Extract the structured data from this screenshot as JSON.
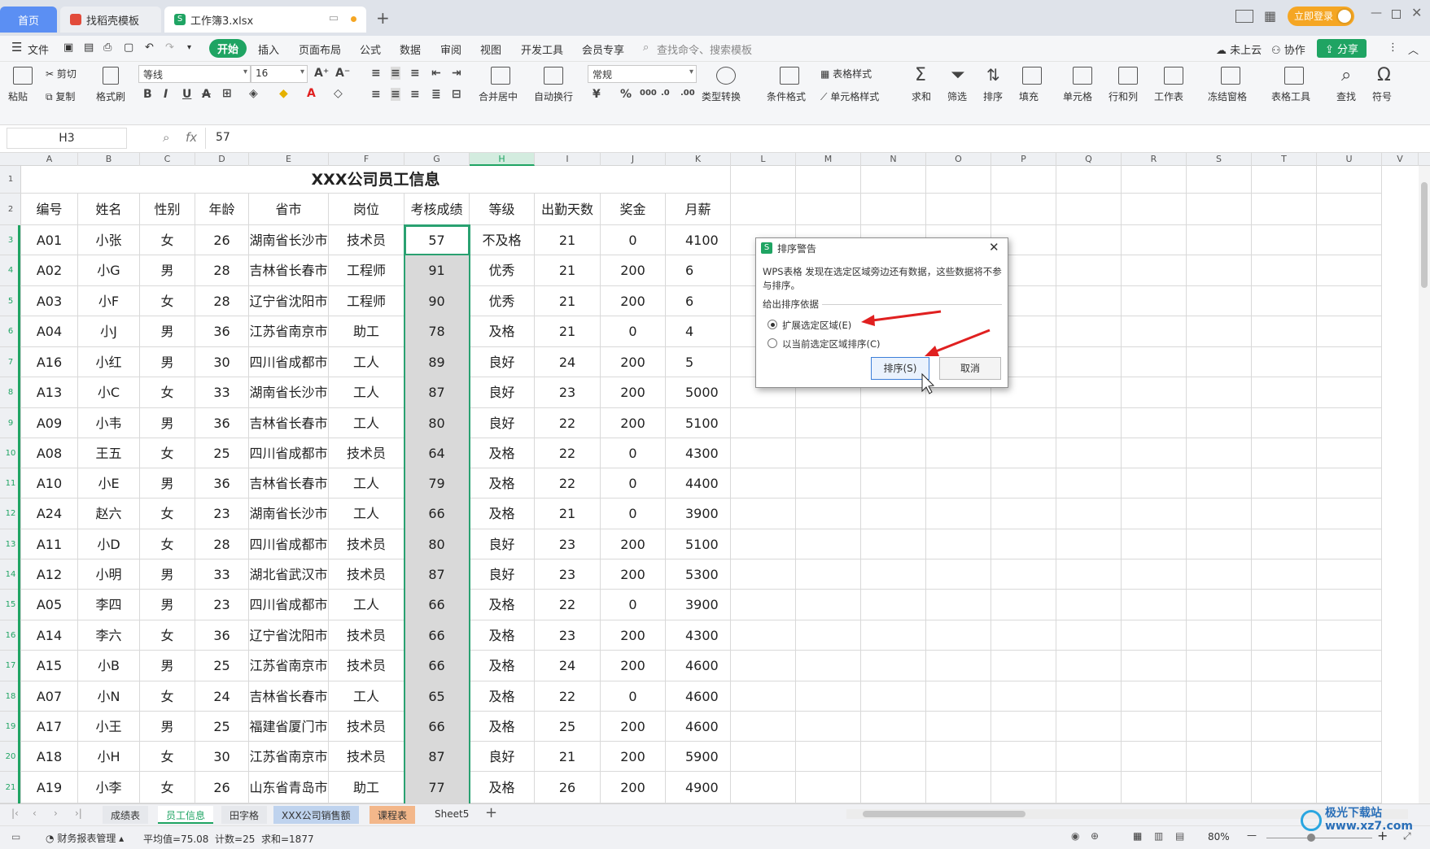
{
  "tabs": {
    "home": "首页",
    "template": "找稻壳模板",
    "workbook": "工作簿3.xlsx",
    "login": "立即登录"
  },
  "menu": {
    "file": "文件",
    "items": [
      "开始",
      "插入",
      "页面布局",
      "公式",
      "数据",
      "审阅",
      "视图",
      "开发工具",
      "会员专享"
    ],
    "search": "查找命令、搜索模板",
    "cloud": "未上云",
    "collab": "协作",
    "share": "分享"
  },
  "ribbon": {
    "paste": "粘贴",
    "cut": "剪切",
    "copy": "复制",
    "format_painter": "格式刷",
    "font_name": "等线",
    "font_size": "16",
    "merge": "合并居中",
    "wrap": "自动换行",
    "number_format": "常规",
    "convert": "类型转换",
    "cond_format": "条件格式",
    "table_style": "表格样式",
    "cell_style": "单元格样式",
    "sum": "求和",
    "filter": "筛选",
    "sort": "排序",
    "fill": "填充",
    "cell": "单元格",
    "rowcol": "行和列",
    "worksheet": "工作表",
    "freeze": "冻结窗格",
    "table_tools": "表格工具",
    "find": "查找",
    "symbol": "符号"
  },
  "formula_bar": {
    "name_box": "H3",
    "fx": "fx",
    "value": "57"
  },
  "columns": [
    "A",
    "B",
    "C",
    "D",
    "E",
    "F",
    "G",
    "H",
    "I",
    "J",
    "K",
    "L",
    "M",
    "N",
    "O",
    "P",
    "Q",
    "R",
    "S",
    "T",
    "U",
    "V"
  ],
  "sheet": {
    "title": "XXX公司员工信息",
    "headers": [
      "编号",
      "姓名",
      "性别",
      "年龄",
      "省市",
      "岗位",
      "考核成绩",
      "等级",
      "出勤天数",
      "奖金",
      "月薪"
    ],
    "rows": [
      [
        "A01",
        "小张",
        "女",
        "26",
        "湖南省长沙市",
        "技术员",
        "57",
        "不及格",
        "21",
        "0",
        "4100"
      ],
      [
        "A02",
        "小G",
        "男",
        "28",
        "吉林省长春市",
        "工程师",
        "91",
        "优秀",
        "21",
        "200",
        "6"
      ],
      [
        "A03",
        "小F",
        "女",
        "28",
        "辽宁省沈阳市",
        "工程师",
        "90",
        "优秀",
        "21",
        "200",
        "6"
      ],
      [
        "A04",
        "小J",
        "男",
        "36",
        "江苏省南京市",
        "助工",
        "78",
        "及格",
        "21",
        "0",
        "4"
      ],
      [
        "A16",
        "小红",
        "男",
        "30",
        "四川省成都市",
        "工人",
        "89",
        "良好",
        "24",
        "200",
        "5"
      ],
      [
        "A13",
        "小C",
        "女",
        "33",
        "湖南省长沙市",
        "工人",
        "87",
        "良好",
        "23",
        "200",
        "5000"
      ],
      [
        "A09",
        "小韦",
        "男",
        "36",
        "吉林省长春市",
        "工人",
        "80",
        "良好",
        "22",
        "200",
        "5100"
      ],
      [
        "A08",
        "王五",
        "女",
        "25",
        "四川省成都市",
        "技术员",
        "64",
        "及格",
        "22",
        "0",
        "4300"
      ],
      [
        "A10",
        "小E",
        "男",
        "36",
        "吉林省长春市",
        "工人",
        "79",
        "及格",
        "22",
        "0",
        "4400"
      ],
      [
        "A24",
        "赵六",
        "女",
        "23",
        "湖南省长沙市",
        "工人",
        "66",
        "及格",
        "21",
        "0",
        "3900"
      ],
      [
        "A11",
        "小D",
        "女",
        "28",
        "四川省成都市",
        "技术员",
        "80",
        "良好",
        "23",
        "200",
        "5100"
      ],
      [
        "A12",
        "小明",
        "男",
        "33",
        "湖北省武汉市",
        "技术员",
        "87",
        "良好",
        "23",
        "200",
        "5300"
      ],
      [
        "A05",
        "李四",
        "男",
        "23",
        "四川省成都市",
        "工人",
        "66",
        "及格",
        "22",
        "0",
        "3900"
      ],
      [
        "A14",
        "李六",
        "女",
        "36",
        "辽宁省沈阳市",
        "技术员",
        "66",
        "及格",
        "23",
        "200",
        "4300"
      ],
      [
        "A15",
        "小B",
        "男",
        "25",
        "江苏省南京市",
        "技术员",
        "66",
        "及格",
        "24",
        "200",
        "4600"
      ],
      [
        "A07",
        "小N",
        "女",
        "24",
        "吉林省长春市",
        "工人",
        "65",
        "及格",
        "22",
        "0",
        "4600"
      ],
      [
        "A17",
        "小王",
        "男",
        "25",
        "福建省厦门市",
        "技术员",
        "66",
        "及格",
        "25",
        "200",
        "4600"
      ],
      [
        "A18",
        "小H",
        "女",
        "30",
        "江苏省南京市",
        "技术员",
        "87",
        "良好",
        "21",
        "200",
        "5900"
      ],
      [
        "A19",
        "小李",
        "女",
        "26",
        "山东省青岛市",
        "助工",
        "77",
        "及格",
        "26",
        "200",
        "4900"
      ]
    ]
  },
  "row_numbers": [
    "1",
    "2",
    "3",
    "4",
    "5",
    "6",
    "7",
    "8",
    "9",
    "10",
    "11",
    "12",
    "13",
    "14",
    "15",
    "16",
    "17",
    "18",
    "19",
    "20",
    "21"
  ],
  "sheet_tabs": [
    "成绩表",
    "员工信息",
    "田字格",
    "XXX公司销售额",
    "课程表",
    "Sheet5"
  ],
  "status": {
    "finance": "财务报表管理",
    "stats": "平均值=75.08  计数=25  求和=1877",
    "zoom": "80%"
  },
  "dialog": {
    "title": "排序警告",
    "message": "WPS表格 发现在选定区域旁边还有数据，这些数据将不参与排序。",
    "section": "给出排序依据",
    "option_expand": "扩展选定区域(E)",
    "option_current": "以当前选定区域排序(C)",
    "ok": "排序(S)",
    "cancel": "取消"
  },
  "watermark": "极光下载站 www.xz7.com",
  "colors": {
    "accent_green": "#1fa463",
    "selection_border": "#2aa171",
    "selected_cells": "#d9d9d9",
    "arrow_red": "#e02020",
    "login_orange": "#f5a623"
  }
}
